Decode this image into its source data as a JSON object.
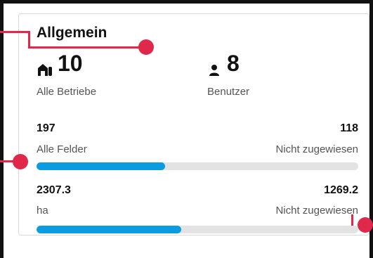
{
  "card": {
    "title": "Allgemein",
    "stats": [
      {
        "value": "10",
        "label": "Alle Betriebe",
        "icon": "farm-icon"
      },
      {
        "value": "8",
        "label": "Benutzer",
        "icon": "user-icon"
      }
    ],
    "fields": {
      "total": "197",
      "total_label": "Alle Felder",
      "unassigned": "118",
      "unassigned_label": "Nicht zugewiesen",
      "progress_fraction": 0.4
    },
    "area": {
      "total": "2307.3",
      "total_label": "ha",
      "unassigned": "1269.2",
      "unassigned_label": "Nicht zugewiesen",
      "progress_fraction": 0.45
    }
  },
  "colors": {
    "accent": "#0a9be0",
    "track": "#e3e3e3",
    "callout": "#e0284b"
  }
}
